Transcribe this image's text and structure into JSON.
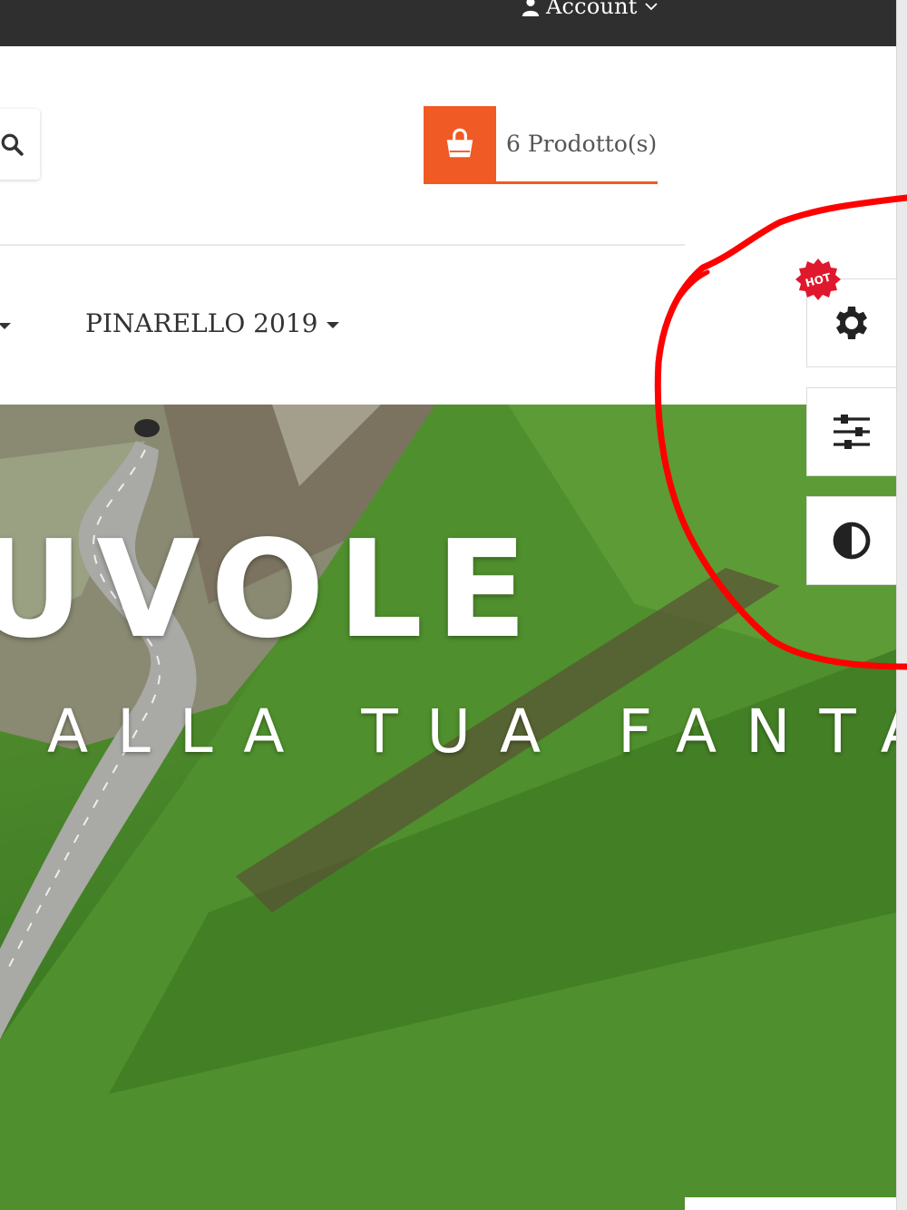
{
  "topbar": {
    "account_label": "Account",
    "user_icon": "user-icon",
    "chevron_icon": "chevron-down-icon"
  },
  "header": {
    "search_icon": "search-icon",
    "cart": {
      "icon": "shopping-bag-icon",
      "label": "6 Prodotto(s)"
    }
  },
  "menu": {
    "items": [
      {
        "label": "PINARELLO 2019"
      }
    ]
  },
  "hero": {
    "title": "UVOLE",
    "subtitle": "ALLA TUA FANTASIA"
  },
  "side_tools": [
    {
      "icon": "gear-icon",
      "badge": "HOT"
    },
    {
      "icon": "sliders-icon"
    },
    {
      "icon": "contrast-icon"
    }
  ],
  "colors": {
    "accent": "#f05a24",
    "topbar": "#2f2f2f",
    "annotation": "#ff0000",
    "badge": "#e0182d"
  }
}
